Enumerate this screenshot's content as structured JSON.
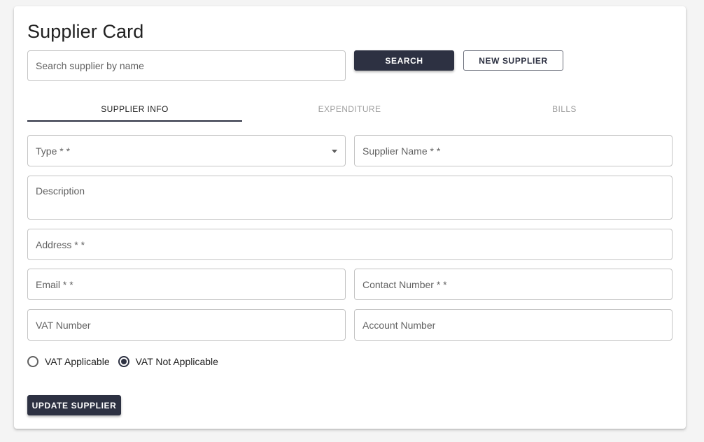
{
  "page": {
    "title": "Supplier Card"
  },
  "search": {
    "placeholder": "Search supplier by name",
    "search_label": "SEARCH",
    "new_label": "NEW SUPPLIER"
  },
  "tabs": [
    {
      "label": "SUPPLIER INFO",
      "active": true
    },
    {
      "label": "EXPENDITURE",
      "active": false
    },
    {
      "label": "BILLS",
      "active": false
    }
  ],
  "form": {
    "type_label": "Type * *",
    "supplier_name_label": "Supplier Name * *",
    "description_label": "Description",
    "address_label": "Address * *",
    "email_label": "Email * *",
    "contact_label": "Contact Number * *",
    "vat_number_label": "VAT Number",
    "account_number_label": "Account Number",
    "vat_options": [
      {
        "label": "VAT Applicable",
        "checked": false
      },
      {
        "label": "VAT Not Applicable",
        "checked": true
      }
    ],
    "update_label": "UPDATE SUPPLIER"
  },
  "colors": {
    "primary": "#2d3142",
    "background": "#f4f4f4",
    "border": "#c4c4c4"
  }
}
